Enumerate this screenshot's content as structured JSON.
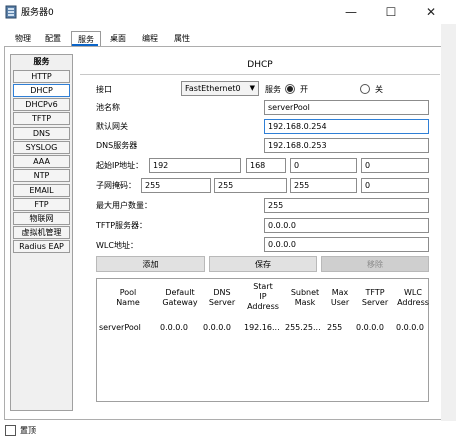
{
  "window": {
    "title": "服务器0",
    "minimize": "—",
    "maximize": "☐",
    "close": "✕"
  },
  "tabs": [
    "物理",
    "配置",
    "服务",
    "桌面",
    "编程",
    "属性"
  ],
  "services": {
    "header": "服务",
    "items": [
      "HTTP",
      "DHCP",
      "DHCPv6",
      "TFTP",
      "DNS",
      "SYSLOG",
      "AAA",
      "NTP",
      "EMAIL",
      "FTP",
      "物联网",
      "虚拟机管理",
      "Radius EAP"
    ],
    "selected": "DHCP"
  },
  "dhcp": {
    "title": "DHCP",
    "interface_label": "接口",
    "interface_value": "FastEthernet0",
    "service_label": "服务",
    "on_label": "开",
    "off_label": "关",
    "service_state": "on",
    "pool_name_label": "池名称",
    "pool_name_value": "serverPool",
    "gateway_label": "默认网关",
    "gateway_value": "192.168.0.254",
    "dns_label": "DNS服务器",
    "dns_value": "192.168.0.253",
    "start_ip_label": "起始IP地址：",
    "start_ip": [
      "192",
      "168",
      "0",
      "0"
    ],
    "mask_label": "子网掩码：",
    "mask": [
      "255",
      "255",
      "255",
      "0"
    ],
    "max_users_label": "最大用户数量：",
    "max_users_value": "255",
    "tftp_label": "TFTP服务器：",
    "tftp_value": "0.0.0.0",
    "wlc_label": "WLC地址：",
    "wlc_value": "0.0.0.0",
    "add_button": "添加",
    "save_button": "保存",
    "remove_button": "移除"
  },
  "table": {
    "headers": [
      "Pool\nName",
      "Default\nGateway",
      "DNS\nServer",
      "Start\nIP\nAddress",
      "Subnet\nMask",
      "Max\nUser",
      "TFTP\nServer",
      "WLC\nAddress"
    ],
    "rows": [
      [
        "serverPool",
        "0.0.0.0",
        "0.0.0.0",
        "192.16...",
        "255.25...",
        "255",
        "0.0.0.0",
        "0.0.0.0"
      ]
    ]
  },
  "footer": {
    "top_checkbox_label": "置顶"
  },
  "colors": {
    "accent": "#2f7fd6",
    "tab_underline": "#0a64c8"
  }
}
